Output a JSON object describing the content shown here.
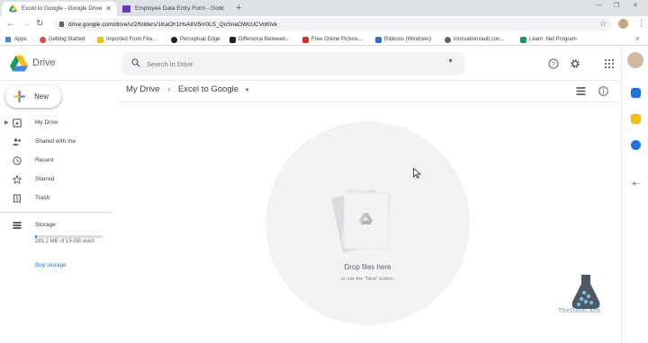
{
  "browser": {
    "tabs": [
      {
        "title": "Excel to Google - Google Drive",
        "active": true
      },
      {
        "title": "Employee Data Entry Form - Goo",
        "active": false
      }
    ],
    "url": "drive.google.com/drive/u/2/folders/1KaOh1HsA8V5m0LS_QoSnaOWcUCVoKtvk",
    "bookmarks": [
      {
        "label": "Apps",
        "color": "#4285f4"
      },
      {
        "label": "Getting Started",
        "color": "#ea4335"
      },
      {
        "label": "Imported From Fire...",
        "color": "#fbbc04"
      },
      {
        "label": "Perceptual Edge",
        "color": "#202124"
      },
      {
        "label": "Difference Between...",
        "color": "#202124"
      },
      {
        "label": "Free Online Picture...",
        "color": "#d93025"
      },
      {
        "label": "Ribbons (Windows)",
        "color": "#1a73e8"
      },
      {
        "label": "innovationvault.con...",
        "color": "#5f6368"
      },
      {
        "label": "Learn .Net Program",
        "color": "#0f9d58"
      }
    ],
    "more_bookmarks": "»"
  },
  "drive": {
    "app_name": "Drive",
    "search_placeholder": "Search in Drive",
    "new_button": "New",
    "nav": [
      {
        "label": "My Drive",
        "icon": "my-drive-icon",
        "expandable": true
      },
      {
        "label": "Shared with me",
        "icon": "shared-icon"
      },
      {
        "label": "Recent",
        "icon": "clock-icon"
      },
      {
        "label": "Starred",
        "icon": "star-icon"
      },
      {
        "label": "Trash",
        "icon": "trash-icon"
      }
    ],
    "storage": {
      "label": "Storage",
      "used_text": "281.2 MB of 15 GB used",
      "used_fraction": 0.02,
      "buy_label": "Buy storage"
    },
    "breadcrumb": {
      "root": "My Drive",
      "separator": "›",
      "current": "Excel to Google"
    },
    "empty_state": {
      "title": "Drop files here",
      "subtitle": "or use the \"New\" button."
    },
    "colors": {
      "blue": "#1a73e8",
      "green": "#34a853",
      "yellow": "#fbbc04",
      "red": "#ea4335"
    }
  },
  "watermark": {
    "text": "TheDataLabs"
  }
}
